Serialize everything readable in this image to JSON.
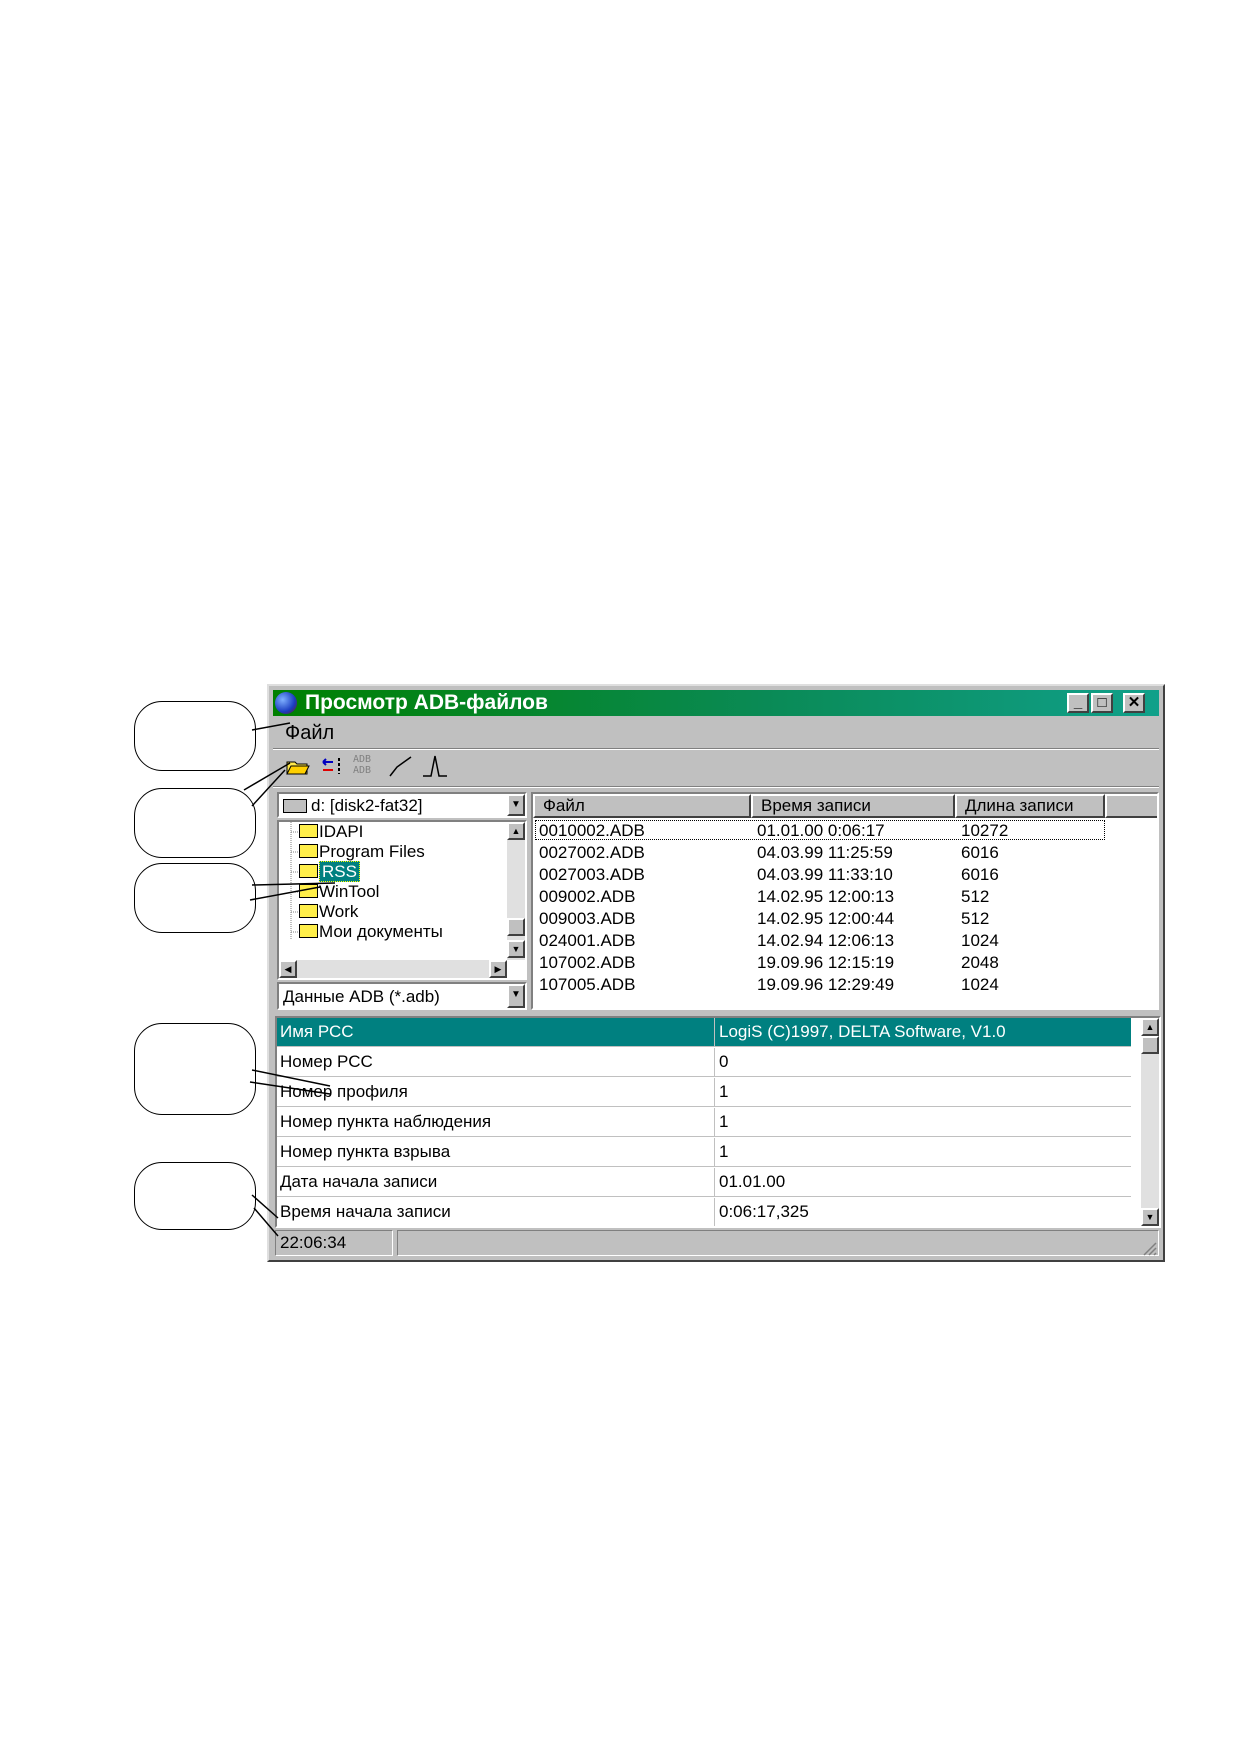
{
  "window": {
    "title": "Просмотр ADB-файлов"
  },
  "menu": {
    "file": "Файл"
  },
  "toolbar": {
    "icons": [
      "open-folder-icon",
      "compare-icon",
      "adb-convert-icon",
      "line-graph-icon",
      "pulse-graph-icon"
    ],
    "adb_label_top": "ADB",
    "adb_label_bottom": "ADB"
  },
  "drive_combo": {
    "value": "d: [disk2-fat32]"
  },
  "folder_tree": {
    "items": [
      "IDAPI",
      "Program Files",
      "RSS",
      "WinTool",
      "Work",
      "Мои документы"
    ],
    "selected": "RSS"
  },
  "filter_combo": {
    "value": "Данные ADB (*.adb)"
  },
  "file_list": {
    "columns": [
      "Файл",
      "Время записи",
      "Длина записи"
    ],
    "rows": [
      [
        "0010002.ADB",
        "01.01.00 0:06:17",
        "10272"
      ],
      [
        "0027002.ADB",
        "04.03.99 11:25:59",
        "6016"
      ],
      [
        "0027003.ADB",
        "04.03.99 11:33:10",
        "6016"
      ],
      [
        "009002.ADB",
        "14.02.95 12:00:13",
        "512"
      ],
      [
        "009003.ADB",
        "14.02.95 12:00:44",
        "512"
      ],
      [
        "024001.ADB",
        "14.02.94 12:06:13",
        "1024"
      ],
      [
        "107002.ADB",
        "19.09.96 12:15:19",
        "2048"
      ],
      [
        "107005.ADB",
        "19.09.96 12:29:49",
        "1024"
      ]
    ]
  },
  "properties": {
    "rows": [
      [
        "Имя РСС",
        "LogiS (C)1997, DELTA Software, V1.0"
      ],
      [
        "Номер РСС",
        "0"
      ],
      [
        "Номер профиля",
        "1"
      ],
      [
        "Номер пункта наблюдения",
        "1"
      ],
      [
        "Номер пункта взрыва",
        "1"
      ],
      [
        "Дата начала записи",
        "01.01.00"
      ],
      [
        "Время начала записи",
        "0:06:17,325"
      ]
    ]
  },
  "status": {
    "time": "22:06:34",
    "message": ""
  },
  "colors": {
    "title_start": "#008000",
    "title_end": "#10a08a",
    "selection": "#008080"
  }
}
